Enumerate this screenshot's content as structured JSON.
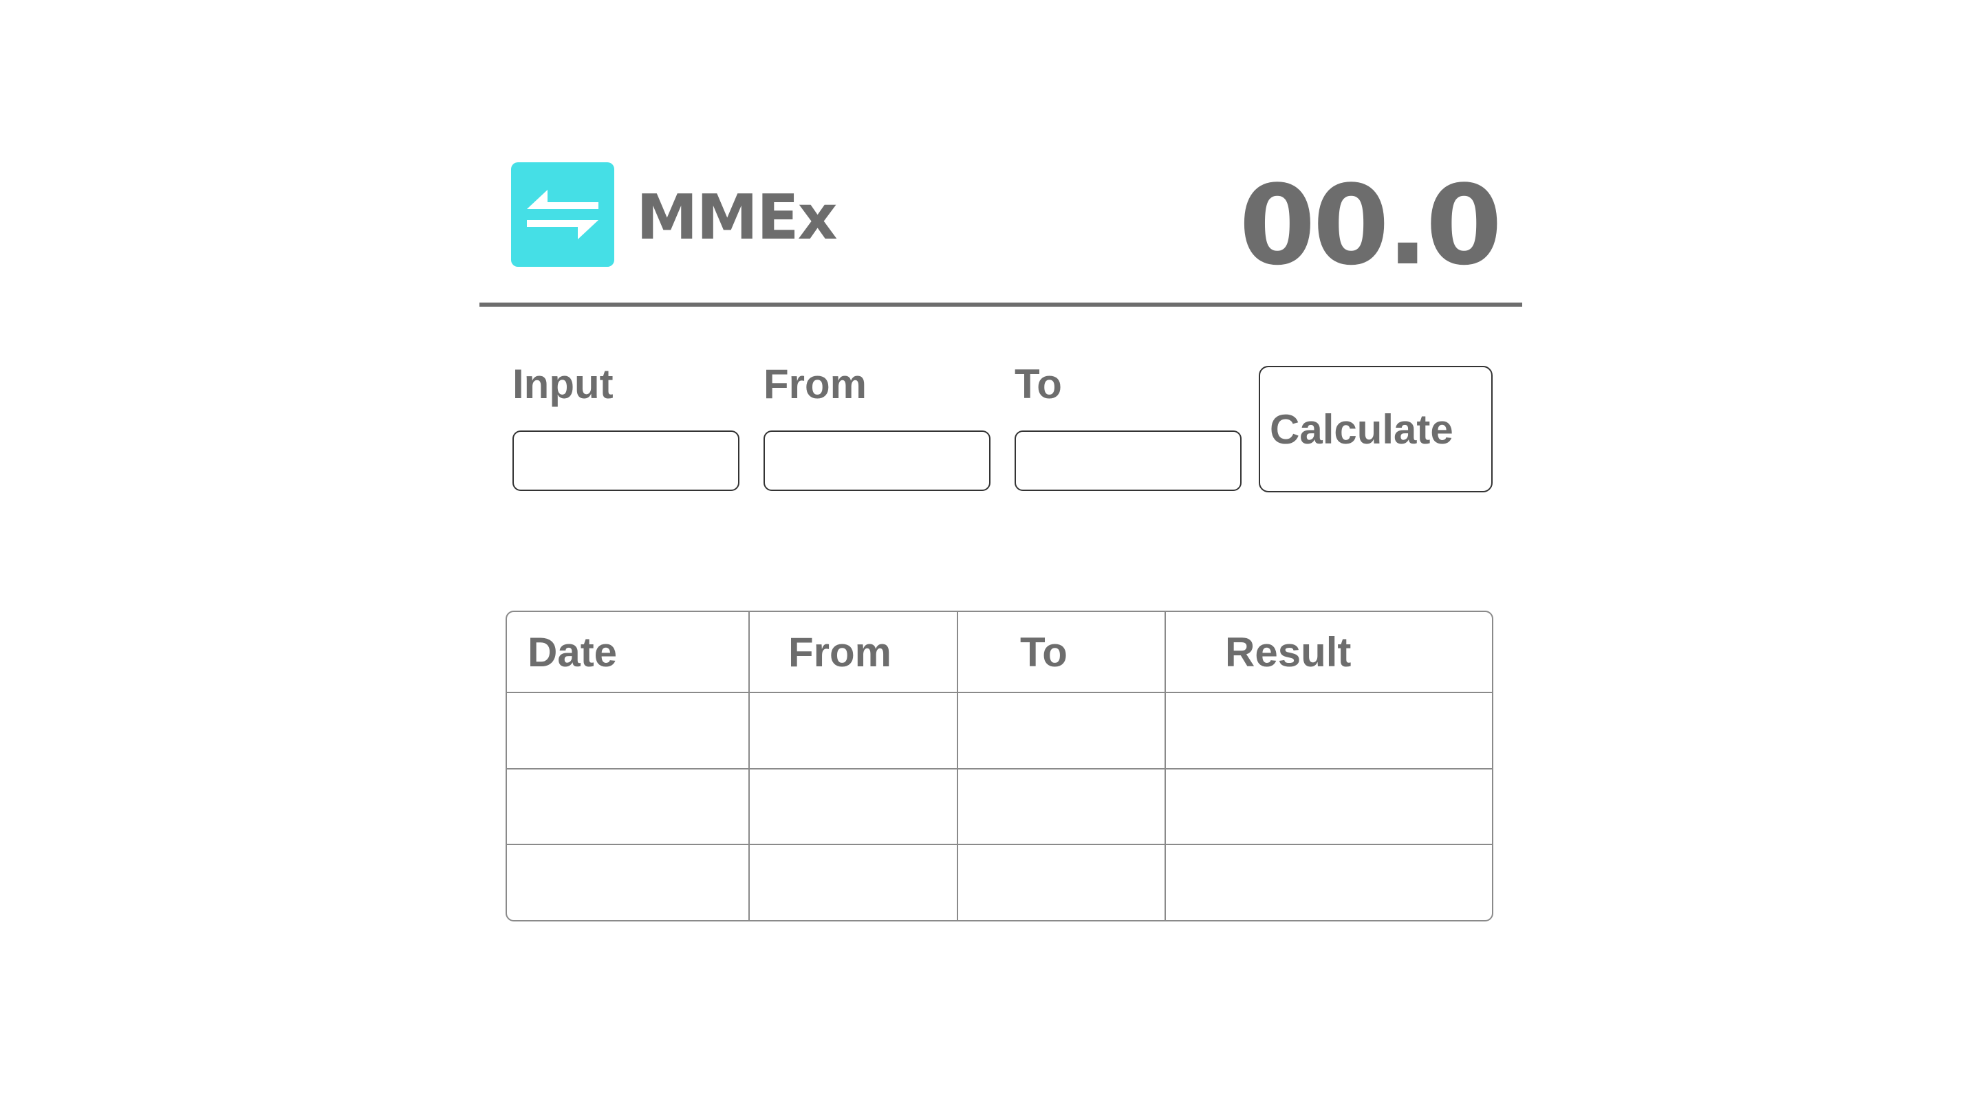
{
  "app": {
    "title": "MMEx",
    "display_value": "00.0",
    "logo_icon": "swap-arrows-icon"
  },
  "colors": {
    "accent": "#45dfe6",
    "text": "#6d6d6d",
    "border": "#333333",
    "table_border": "#8a8a8a",
    "background": "#ffffff"
  },
  "form": {
    "input_label": "Input",
    "input_value": "",
    "from_label": "From",
    "from_value": "",
    "to_label": "To",
    "to_value": "",
    "calculate_label": "Calculate"
  },
  "history": {
    "columns": [
      "Date",
      "From",
      "To",
      "Result"
    ],
    "rows": [
      [
        "",
        "",
        "",
        ""
      ],
      [
        "",
        "",
        "",
        ""
      ],
      [
        "",
        "",
        "",
        ""
      ]
    ]
  }
}
